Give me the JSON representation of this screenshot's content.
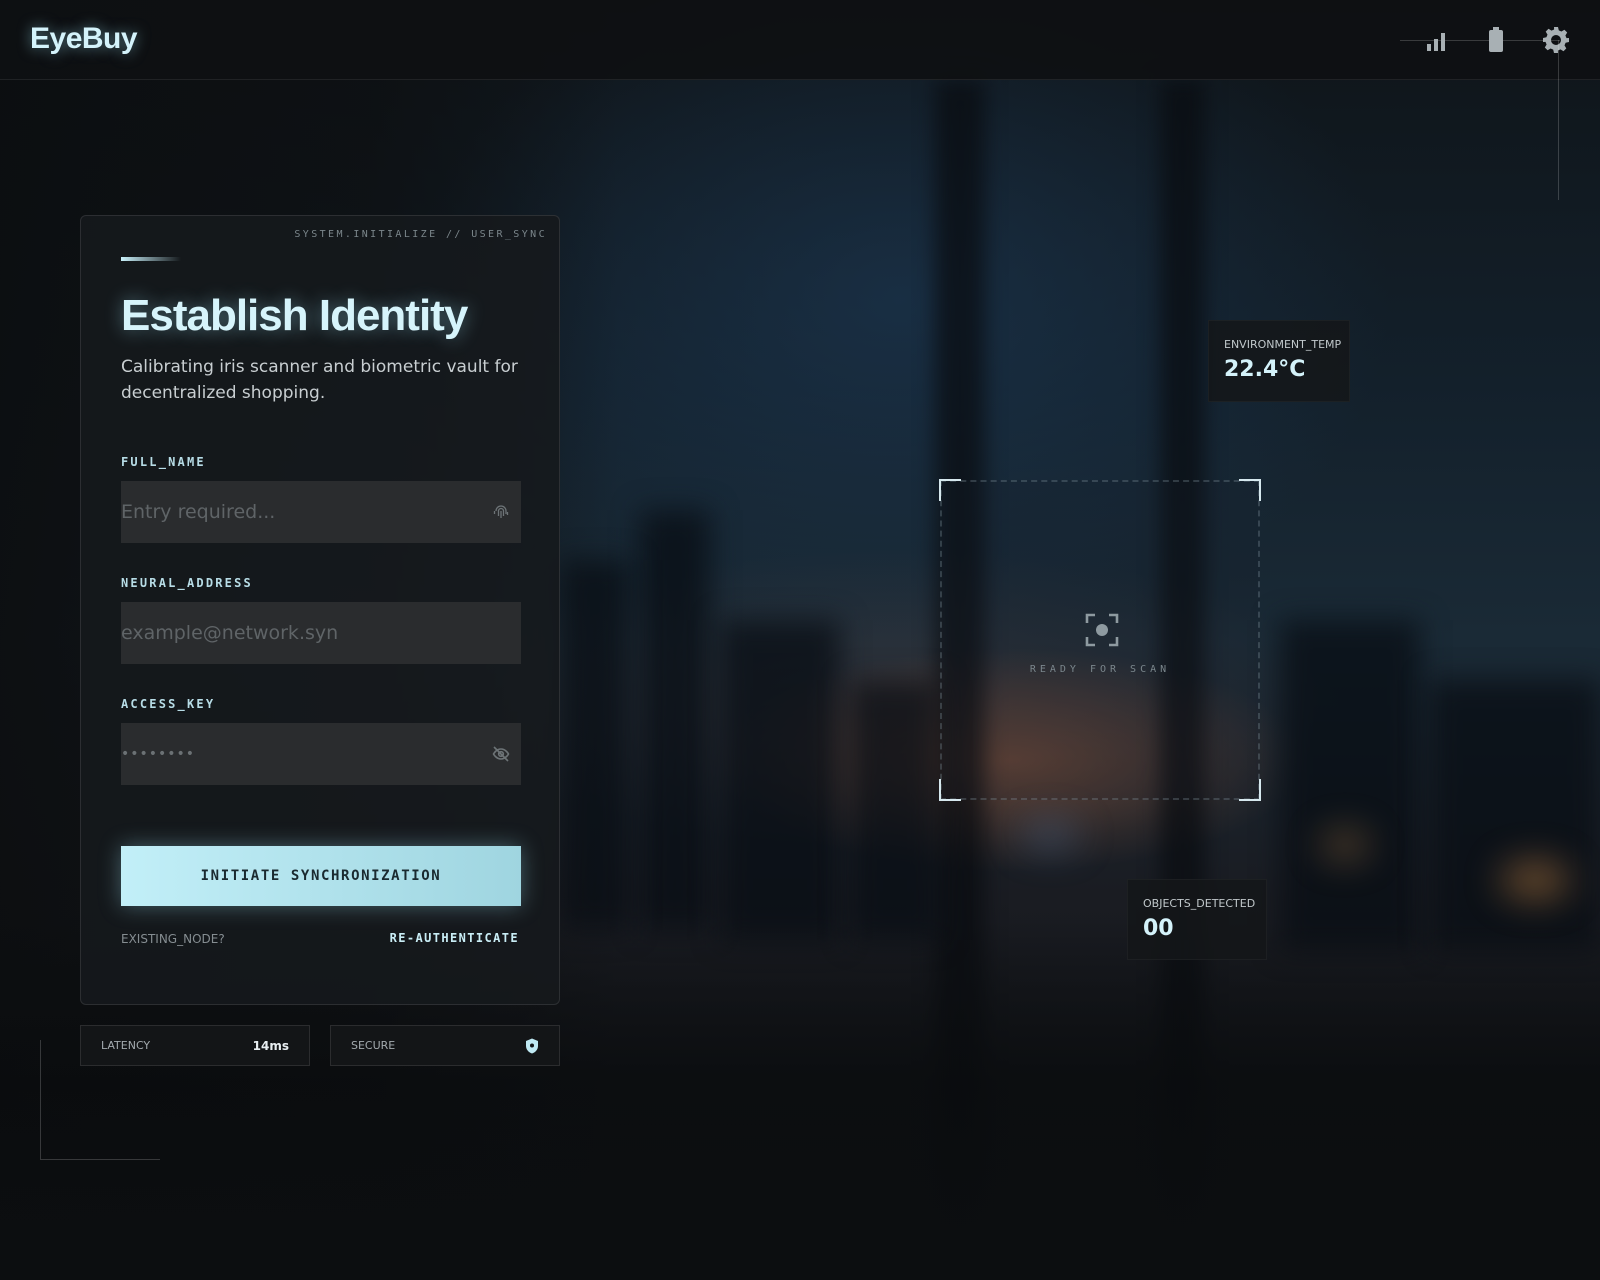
{
  "app": {
    "name": "EyeBuy"
  },
  "header": {
    "icons": [
      "signal-icon",
      "battery-icon",
      "settings-gear-icon"
    ]
  },
  "card": {
    "system_tag": "SYSTEM.INITIALIZE // USER_SYNC",
    "title": "Establish Identity",
    "subtitle": "Calibrating iris scanner and biometric vault for decentralized shopping.",
    "fields": [
      {
        "label": "FULL_NAME",
        "placeholder": "Entry required...",
        "icon": "fingerprint-icon"
      },
      {
        "label": "NEURAL_ADDRESS",
        "placeholder": "example@network.syn"
      },
      {
        "label": "ACCESS_KEY",
        "placeholder": "••••••••",
        "icon": "eye-off-icon"
      }
    ],
    "cta_label": "INITIATE SYNCHRONIZATION",
    "existing_label": "EXISTING_NODE?",
    "reauth_label": "RE-AUTHENTICATE"
  },
  "stats": {
    "latency_label": "LATENCY",
    "latency_value": "14ms",
    "secure_label": "SECURE",
    "secure_icon": "shield-icon"
  },
  "readouts": {
    "env_label": "ENVIRONMENT_TEMP",
    "env_value": "22.4°C",
    "objects_label": "OBJECTS_DETECTED",
    "objects_value": "00"
  },
  "scanner": {
    "status": "READY FOR SCAN",
    "icon": "scan-focus-icon"
  },
  "colors": {
    "accent": "#c2eff8",
    "accent_glow": "#d6f4fb",
    "panel": "#16191c",
    "input": "#2a2c2e"
  }
}
